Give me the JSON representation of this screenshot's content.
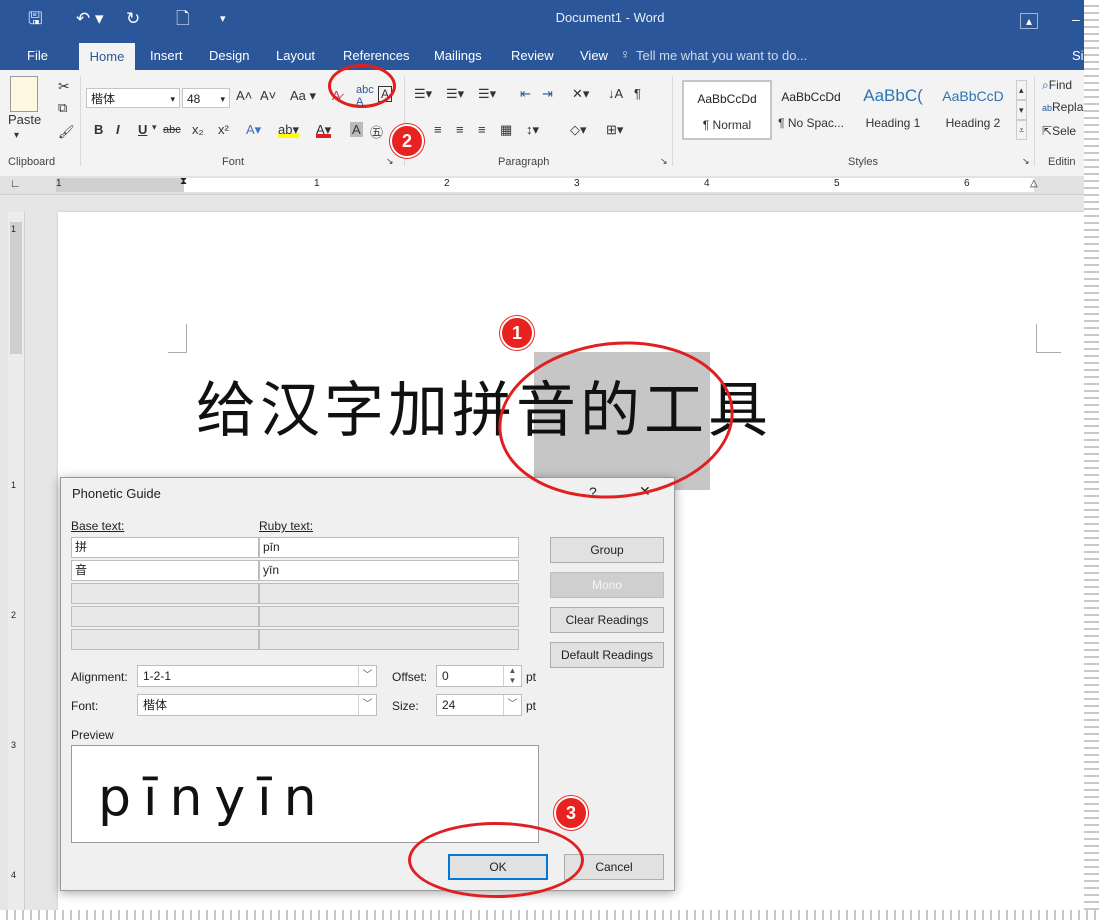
{
  "titlebar": {
    "document_title": "Document1 - Word",
    "save_icon": "save-icon",
    "undo_icon": "undo-icon",
    "redo_icon": "redo-icon",
    "preview_icon": "print-preview-icon",
    "customize_icon": "customize-icon"
  },
  "tabs": {
    "file": "File",
    "home": "Home",
    "insert": "Insert",
    "design": "Design",
    "layout": "Layout",
    "references": "References",
    "mailings": "Mailings",
    "review": "Review",
    "view": "View",
    "tell_me": "Tell me what you want to do...",
    "signin_partial": "Si"
  },
  "ribbon": {
    "clipboard": {
      "paste": "Paste",
      "label": "Clipboard"
    },
    "font": {
      "font_name": "楷体",
      "font_size": "48",
      "bold": "B",
      "italic": "I",
      "underline": "U",
      "strikethrough": "abc",
      "subscript": "x₂",
      "superscript": "x²",
      "aa": "Aa",
      "label": "Font"
    },
    "paragraph": {
      "label": "Paragraph"
    },
    "styles": {
      "label": "Styles",
      "items": [
        {
          "sample": "AaBbCcDd",
          "name": "¶ Normal"
        },
        {
          "sample": "AaBbCcDd",
          "name": "¶ No Spac..."
        },
        {
          "sample": "AaBbC(",
          "name": "Heading 1"
        },
        {
          "sample": "AaBbCcD",
          "name": "Heading 2"
        }
      ]
    },
    "editing": {
      "find": "Find",
      "replace": "Repla",
      "select": "Sele",
      "label": "Editin"
    }
  },
  "ruler": {
    "marks": [
      "1",
      "1",
      "2",
      "3",
      "4",
      "5",
      "6"
    ]
  },
  "vruler": {
    "marks": [
      "1",
      "1",
      "2",
      "3",
      "4"
    ]
  },
  "document": {
    "text": "给汉字加拼音的工具"
  },
  "dialog": {
    "title": "Phonetic Guide",
    "help": "?",
    "close": "✕",
    "base_text_label": "Base text:",
    "ruby_text_label": "Ruby text:",
    "rows": [
      {
        "base": "拼",
        "ruby": "pīn"
      },
      {
        "base": "音",
        "ruby": "yīn"
      },
      {
        "base": "",
        "ruby": ""
      },
      {
        "base": "",
        "ruby": ""
      },
      {
        "base": "",
        "ruby": ""
      }
    ],
    "buttons": {
      "group": "Group",
      "mono": "Mono",
      "clear_readings": "Clear Readings",
      "default_readings": "Default Readings",
      "ok": "OK",
      "cancel": "Cancel"
    },
    "alignment_label": "Alignment:",
    "alignment_value": "1-2-1",
    "font_label": "Font:",
    "font_value": "楷体",
    "offset_label": "Offset:",
    "offset_value": "0",
    "size_label": "Size:",
    "size_value": "24",
    "pt": "pt",
    "preview_label": "Preview",
    "preview_text": "pīnyīn"
  },
  "annotations": {
    "one": "1",
    "two": "2",
    "three": "3"
  },
  "colors": {
    "word_blue": "#2b579a",
    "annotation_red": "#e8231f",
    "selection": "#c6c6c6"
  }
}
